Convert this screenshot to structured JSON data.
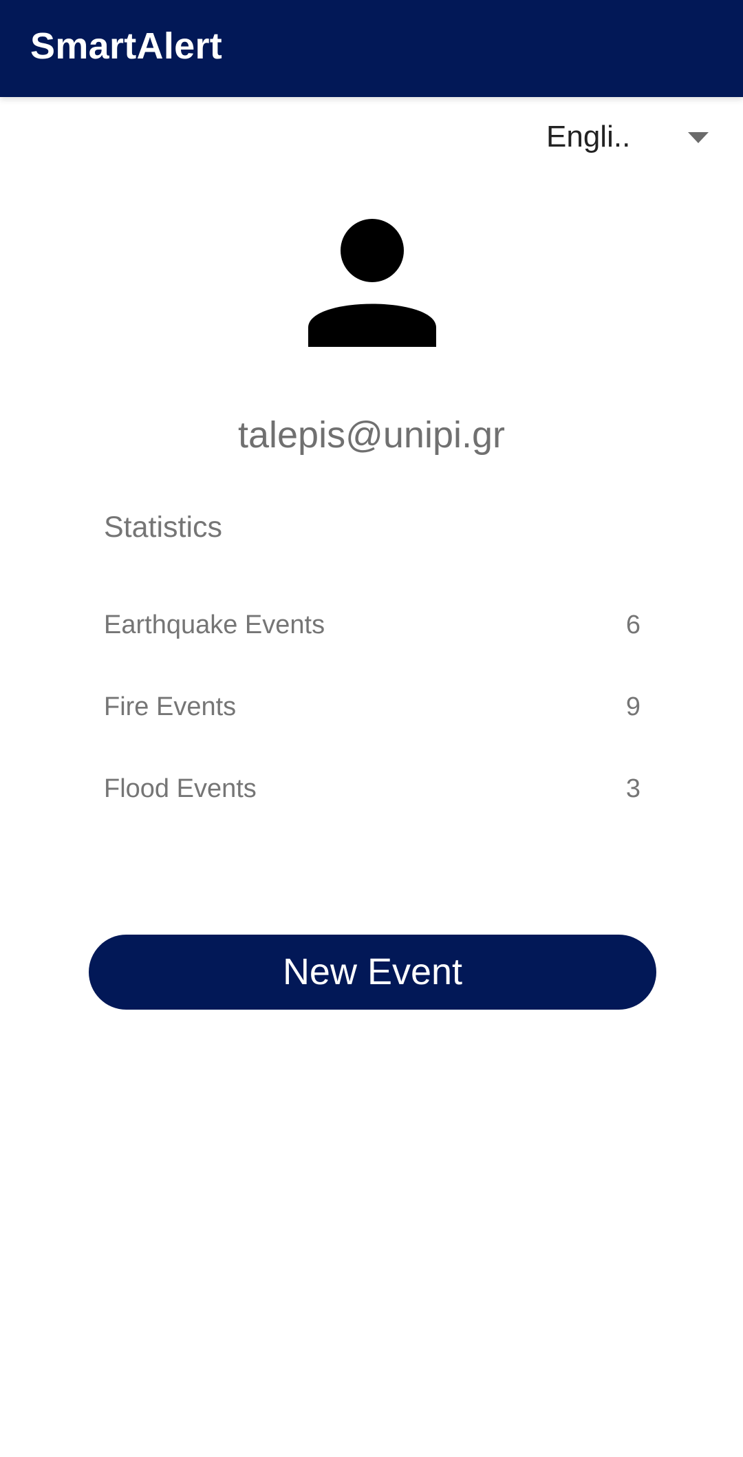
{
  "app_bar": {
    "title": "SmartAlert",
    "background_color": "#021857"
  },
  "language_selector": {
    "selected": "Engli.."
  },
  "profile": {
    "avatar_icon": "person-icon",
    "email": "talepis@unipi.gr"
  },
  "statistics": {
    "title": "Statistics",
    "rows": [
      {
        "label": "Earthquake Events",
        "value": "6"
      },
      {
        "label": "Fire Events",
        "value": "9"
      },
      {
        "label": "Flood Events",
        "value": "3"
      }
    ]
  },
  "actions": {
    "new_event_label": "New Event",
    "accent_color": "#021857"
  }
}
